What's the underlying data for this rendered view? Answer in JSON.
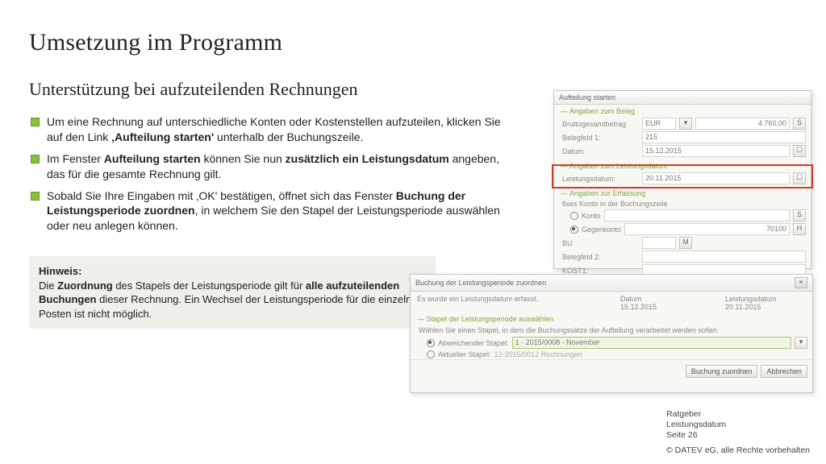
{
  "title": "Umsetzung im Programm",
  "subtitle": "Unterstützung bei aufzuteilenden Rechnungen",
  "bullets": {
    "b1a": "Um eine Rechnung auf unterschiedliche Konten oder Kostenstellen aufzuteilen, klicken Sie auf den Link ",
    "b1b": "‚Aufteilung starten'",
    "b1c": " unterhalb der Buchungszeile.",
    "b2a": "Im Fenster ",
    "b2b": "Aufteilung starten",
    "b2c": " können Sie nun ",
    "b2d": "zusätzlich ein Leistungsdatum",
    "b2e": " angeben, das für die gesamte Rechnung gilt.",
    "b3a": "Sobald Sie Ihre Eingaben mit ‚OK' bestätigen, öffnet sich das Fenster ",
    "b3b": "Buchung der Leistungsperiode zuordnen",
    "b3c": ", in welchem Sie den Stapel der Leistungsperiode auswählen oder neu anlegen können."
  },
  "hint": {
    "label": "Hinweis:",
    "t1": "Die ",
    "t2": "Zuordnung",
    "t3": " des Stapels der Leistungsperiode gilt für ",
    "t4": "alle aufzuteilenden Buchungen",
    "t5": " dieser Rechnung. Ein Wechsel der Leistungsperiode für die einzelnen Posten ist nicht möglich."
  },
  "dialog1": {
    "title": "Aufteilung starten",
    "sec1": "— Angaben zum Beleg",
    "l_brutto": "Bruttogesamtbetrag",
    "v_cur": "EUR",
    "v_brutto": "4.760,00",
    "l_beleg1": "Belegfeld 1:",
    "v_beleg1": "215",
    "l_datum": "Datum",
    "v_datum": "15.12.2015",
    "sec2": "— Angaben zum Leistungsdatum",
    "l_ldat": "Leistungsdatum:",
    "v_ldat": "20.11.2015",
    "sec3": "— Angaben zur Erfassung",
    "l_fix": "fixes Konto in der Buchungszeile",
    "r_konto": "Konto",
    "r_gegen": "Gegenkonto",
    "v_gegen": "70100",
    "l_bu": "BU",
    "l_beleg2": "Belegfeld 2:",
    "l_kost1": "KOST1:"
  },
  "dialog2": {
    "title": "Buchung der Leistungsperiode zuordnen",
    "msg": "Es wurde ein Leistungsdatum erfasst.",
    "col_datum": "Datum",
    "col_ld": "Leistungsdatum",
    "v_datum": "15.12.2015",
    "v_ld": "20.11.2015",
    "sec": "— Stapel der Leistungsperiode auswählen",
    "hint": "Wählen Sie einen Stapel, in dem die Buchungssätze der Aufteilung verarbeitet werden sollen.",
    "r_abw": "Abweichender Stapel:",
    "v_abw": "1 - 2015/0008 - November",
    "r_akt": "Aktueller Stapel:",
    "v_akt": "12-2015/0012 Rechnungen",
    "btn_ok": "Buchung zuordnen",
    "btn_cancel": "Abbrechen"
  },
  "footer": {
    "l1": "Ratgeber",
    "l2": "Leistungsdatum",
    "l3a": "Seite ",
    "l3b": "26",
    "copy": "© DATEV eG, alle Rechte vorbehalten"
  },
  "icons": {
    "s": "S",
    "h": "H",
    "m": "M",
    "x": "×",
    "dd": "▾",
    "cal": "☐"
  }
}
